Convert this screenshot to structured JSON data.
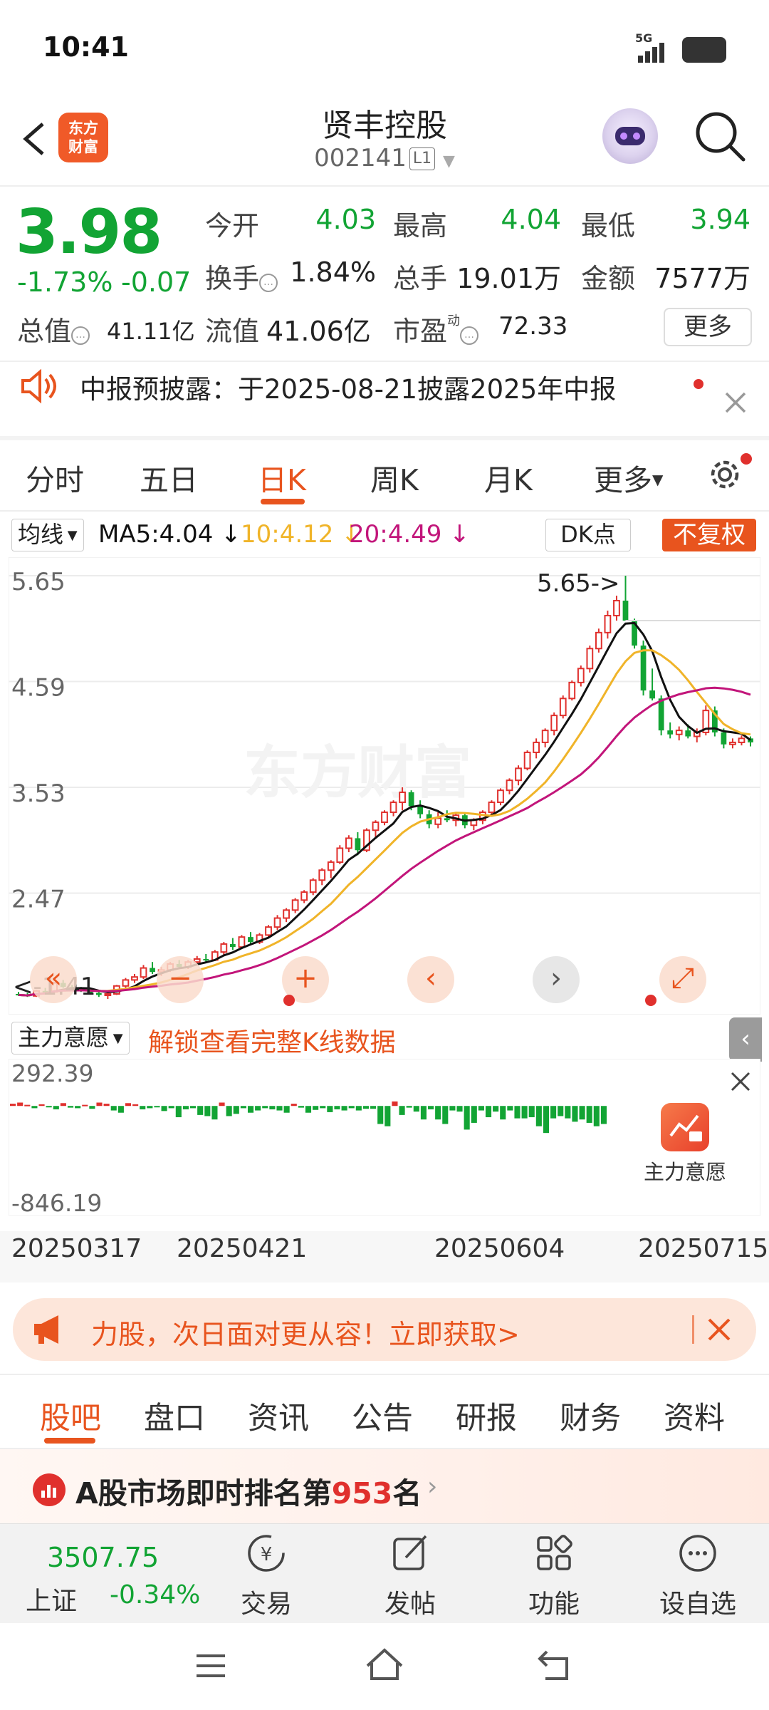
{
  "status_bar": {
    "time": "10:41",
    "network": "5G"
  },
  "header": {
    "logo_line1": "东方",
    "logo_line2": "财富",
    "stock_name": "贤丰控股",
    "stock_code": "002141",
    "code_badge": "L1"
  },
  "quote": {
    "price": "3.98",
    "change_pct": "-1.73%",
    "change_val": "-0.07",
    "open_label": "今开",
    "open": "4.03",
    "high_label": "最高",
    "high": "4.04",
    "low_label": "最低",
    "low": "3.94",
    "turnover_label": "换手",
    "turnover": "1.84%",
    "volume_label": "总手",
    "volume": "19.01万",
    "amount_label": "金额",
    "amount": "7577万",
    "mcap_label": "总值",
    "mcap": "41.11亿",
    "float_label": "流值",
    "float_cap": "41.06亿",
    "pe_label": "市盈",
    "pe_sup": "动",
    "pe": "72.33",
    "more_label": "更多"
  },
  "notice": {
    "text": "中报预披露：于2025-08-21披露2025年中报"
  },
  "period_tabs": [
    "分时",
    "五日",
    "日K",
    "周K",
    "月K",
    "更多"
  ],
  "ma_bar": {
    "select_label": "均线",
    "ma5": "MA5:4.04 ↓",
    "ma10": "10:4.12 ↓",
    "ma20": "20:4.49 ↓",
    "dk_label": "DK点",
    "fq_label": "不复权"
  },
  "colors": {
    "up": "#e0302d",
    "down": "#12a434",
    "ma5": "#111111",
    "ma10": "#f0b429",
    "ma20": "#c2157a",
    "accent": "#e8541e"
  },
  "chart_data": {
    "type": "candlestick",
    "y_ticks": [
      "5.65",
      "4.59",
      "3.53",
      "2.47"
    ],
    "ylim": [
      1.41,
      5.65
    ],
    "max_marker": "5.65->",
    "min_marker": "<-1.41",
    "x_ticks": [
      "20250317",
      "20250421",
      "20250604",
      "20250715"
    ],
    "candles": [
      [
        1.46,
        1.48,
        1.44,
        1.45
      ],
      [
        1.45,
        1.47,
        1.43,
        1.44
      ],
      [
        1.44,
        1.5,
        1.43,
        1.49
      ],
      [
        1.49,
        1.52,
        1.47,
        1.48
      ],
      [
        1.48,
        1.58,
        1.47,
        1.57
      ],
      [
        1.57,
        1.6,
        1.52,
        1.53
      ],
      [
        1.53,
        1.55,
        1.49,
        1.51
      ],
      [
        1.51,
        1.53,
        1.48,
        1.5
      ],
      [
        1.5,
        1.52,
        1.46,
        1.47
      ],
      [
        1.47,
        1.49,
        1.43,
        1.45
      ],
      [
        1.45,
        1.47,
        1.41,
        1.46
      ],
      [
        1.46,
        1.55,
        1.45,
        1.54
      ],
      [
        1.54,
        1.62,
        1.52,
        1.6
      ],
      [
        1.6,
        1.66,
        1.57,
        1.63
      ],
      [
        1.63,
        1.75,
        1.61,
        1.72
      ],
      [
        1.72,
        1.78,
        1.66,
        1.68
      ],
      [
        1.68,
        1.73,
        1.64,
        1.7
      ],
      [
        1.7,
        1.78,
        1.68,
        1.76
      ],
      [
        1.76,
        1.8,
        1.71,
        1.73
      ],
      [
        1.73,
        1.8,
        1.71,
        1.78
      ],
      [
        1.78,
        1.84,
        1.75,
        1.81
      ],
      [
        1.81,
        1.86,
        1.78,
        1.8
      ],
      [
        1.8,
        1.9,
        1.79,
        1.88
      ],
      [
        1.88,
        1.98,
        1.85,
        1.96
      ],
      [
        1.96,
        2.02,
        1.9,
        1.93
      ],
      [
        1.93,
        2.05,
        1.91,
        2.03
      ],
      [
        2.03,
        2.08,
        1.95,
        1.98
      ],
      [
        1.98,
        2.07,
        1.96,
        2.05
      ],
      [
        2.05,
        2.15,
        2.03,
        2.13
      ],
      [
        2.13,
        2.25,
        2.1,
        2.22
      ],
      [
        2.22,
        2.32,
        2.18,
        2.3
      ],
      [
        2.3,
        2.42,
        2.27,
        2.4
      ],
      [
        2.4,
        2.5,
        2.37,
        2.48
      ],
      [
        2.48,
        2.62,
        2.45,
        2.6
      ],
      [
        2.6,
        2.72,
        2.55,
        2.7
      ],
      [
        2.7,
        2.8,
        2.62,
        2.78
      ],
      [
        2.78,
        2.95,
        2.76,
        2.92
      ],
      [
        2.92,
        3.05,
        2.88,
        3.02
      ],
      [
        3.02,
        3.08,
        2.85,
        2.9
      ],
      [
        2.9,
        3.12,
        2.88,
        3.1
      ],
      [
        3.1,
        3.2,
        3.02,
        3.18
      ],
      [
        3.18,
        3.3,
        3.15,
        3.28
      ],
      [
        3.28,
        3.4,
        3.24,
        3.38
      ],
      [
        3.38,
        3.53,
        3.3,
        3.48
      ],
      [
        3.48,
        3.5,
        3.3,
        3.34
      ],
      [
        3.34,
        3.4,
        3.22,
        3.26
      ],
      [
        3.26,
        3.3,
        3.12,
        3.16
      ],
      [
        3.16,
        3.28,
        3.12,
        3.22
      ],
      [
        3.22,
        3.3,
        3.18,
        3.2
      ],
      [
        3.2,
        3.27,
        3.14,
        3.25
      ],
      [
        3.25,
        3.28,
        3.12,
        3.15
      ],
      [
        3.15,
        3.22,
        3.1,
        3.2
      ],
      [
        3.2,
        3.3,
        3.16,
        3.28
      ],
      [
        3.28,
        3.4,
        3.25,
        3.38
      ],
      [
        3.38,
        3.52,
        3.35,
        3.5
      ],
      [
        3.5,
        3.62,
        3.46,
        3.6
      ],
      [
        3.6,
        3.75,
        3.55,
        3.72
      ],
      [
        3.72,
        3.9,
        3.7,
        3.88
      ],
      [
        3.88,
        4.02,
        3.82,
        3.98
      ],
      [
        3.98,
        4.12,
        3.93,
        4.1
      ],
      [
        4.1,
        4.28,
        4.05,
        4.25
      ],
      [
        4.25,
        4.45,
        4.22,
        4.42
      ],
      [
        4.42,
        4.6,
        4.4,
        4.58
      ],
      [
        4.58,
        4.75,
        4.54,
        4.72
      ],
      [
        4.72,
        4.95,
        4.68,
        4.92
      ],
      [
        4.92,
        5.12,
        4.88,
        5.08
      ],
      [
        5.08,
        5.3,
        5.02,
        5.25
      ],
      [
        5.25,
        5.45,
        5.2,
        5.4
      ],
      [
        5.4,
        5.65,
        5.3,
        5.2
      ],
      [
        5.2,
        5.22,
        4.92,
        4.95
      ],
      [
        4.95,
        5.0,
        4.45,
        4.5
      ],
      [
        4.5,
        4.72,
        4.4,
        4.42
      ],
      [
        4.42,
        4.45,
        4.05,
        4.1
      ],
      [
        4.1,
        4.18,
        4.02,
        4.06
      ],
      [
        4.06,
        4.14,
        4.0,
        4.1
      ],
      [
        4.1,
        4.16,
        4.02,
        4.04
      ],
      [
        4.04,
        4.12,
        3.98,
        4.08
      ],
      [
        4.08,
        4.35,
        4.05,
        4.3
      ],
      [
        4.3,
        4.34,
        4.04,
        4.08
      ],
      [
        4.08,
        4.12,
        3.92,
        3.96
      ],
      [
        3.96,
        4.02,
        3.92,
        3.98
      ],
      [
        3.98,
        4.05,
        3.95,
        4.02
      ],
      [
        4.02,
        4.04,
        3.94,
        3.98
      ]
    ],
    "indicator": {
      "name": "主力意愿",
      "ylim": [
        -846.19,
        292.39
      ],
      "y_ticks": [
        "292.39",
        "-846.19"
      ],
      "values": [
        20,
        30,
        10,
        -20,
        15,
        -10,
        -30,
        25,
        -15,
        -20,
        10,
        -25,
        30,
        20,
        -40,
        -60,
        25,
        15,
        -30,
        -20,
        -10,
        -45,
        -20,
        -100,
        -30,
        -20,
        -80,
        -90,
        -120,
        30,
        -90,
        -70,
        -20,
        -60,
        -40,
        -20,
        -30,
        -40,
        -60,
        20,
        -15,
        -60,
        -35,
        -20,
        -55,
        -30,
        -40,
        -20,
        -40,
        -25,
        -25,
        -160,
        -180,
        40,
        -80,
        -15,
        -50,
        -120,
        -30,
        -120,
        -160,
        -40,
        -50,
        -210,
        -150,
        -40,
        -100,
        -50,
        -120,
        -40,
        -110,
        -110,
        -100,
        -180,
        -240,
        -110,
        -90,
        -110,
        -140,
        -120,
        -150,
        -180,
        -160
      ]
    }
  },
  "chart_labels": {
    "indicator_select": "主力意愿",
    "unlock": "解锁查看完整K线数据",
    "card_label": "主力意愿"
  },
  "promo": {
    "text": "力股，次日面对更从容！立即获取>"
  },
  "content_tabs": [
    "股吧",
    "盘口",
    "资讯",
    "公告",
    "研报",
    "财务",
    "资料"
  ],
  "rank": {
    "prefix": "A股市场即时排名第",
    "number": "953",
    "suffix": "名"
  },
  "bottom_bar": {
    "index_value": "3507.75",
    "index_name": "上证",
    "index_change": "-0.34%",
    "items": [
      "交易",
      "发帖",
      "功能",
      "设自选"
    ]
  }
}
